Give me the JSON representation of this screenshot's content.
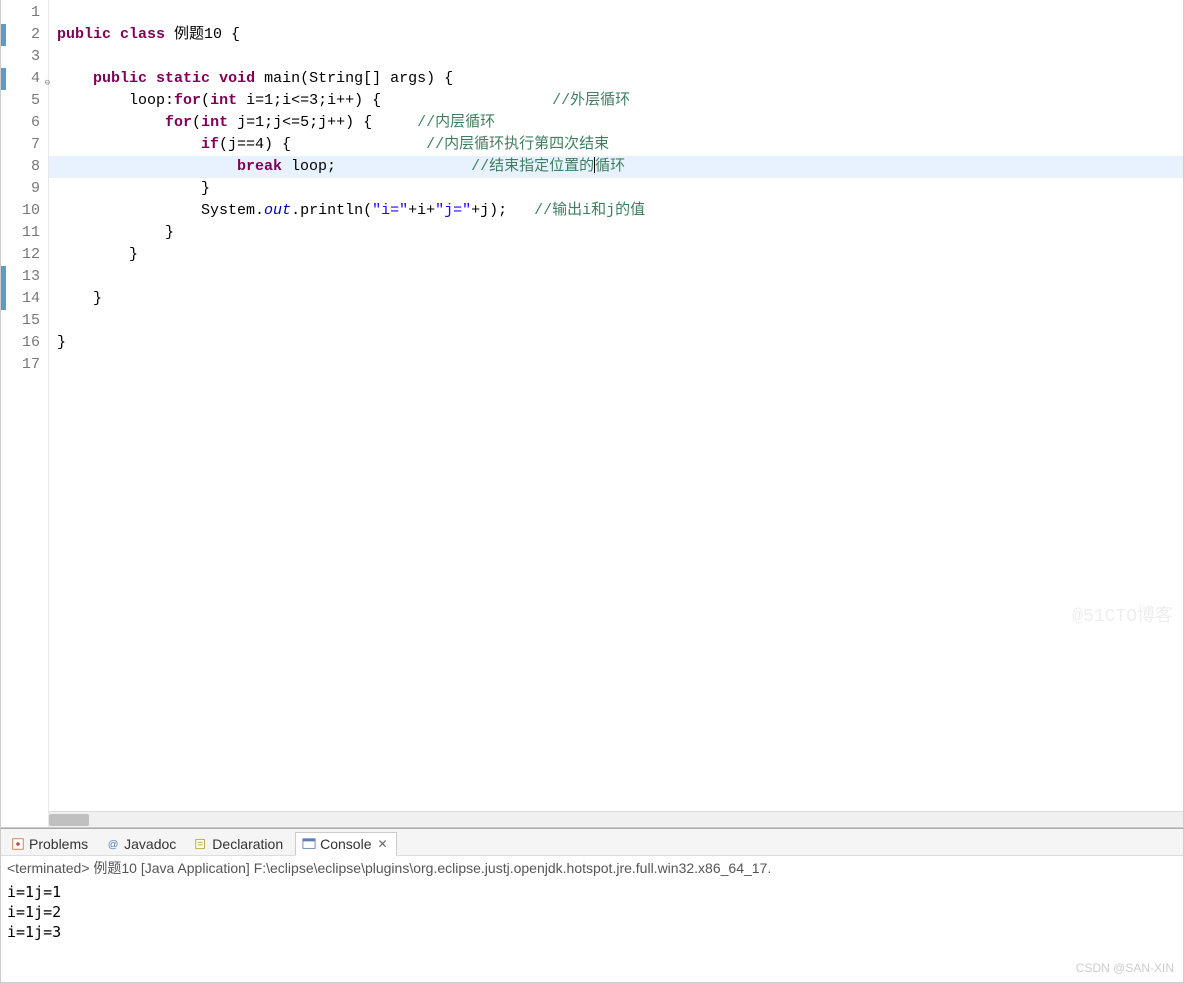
{
  "gutter": {
    "lines": [
      {
        "n": "1"
      },
      {
        "n": "2",
        "blue": true
      },
      {
        "n": "3"
      },
      {
        "n": "4",
        "blue": true,
        "fold": "⊖"
      },
      {
        "n": "5"
      },
      {
        "n": "6"
      },
      {
        "n": "7"
      },
      {
        "n": "8"
      },
      {
        "n": "9"
      },
      {
        "n": "10"
      },
      {
        "n": "11"
      },
      {
        "n": "12"
      },
      {
        "n": "13",
        "blue": true
      },
      {
        "n": "14",
        "blue": true
      },
      {
        "n": "15"
      },
      {
        "n": "16"
      },
      {
        "n": "17"
      }
    ]
  },
  "code": {
    "l1": "",
    "l2": {
      "k1": "public",
      "sp1": " ",
      "k2": "class",
      "rest": " 例题10 {"
    },
    "l3": "",
    "l4": {
      "pad": "    ",
      "k1": "public",
      "sp1": " ",
      "k2": "static",
      "sp2": " ",
      "k3": "void",
      "rest": " main(String[] args) {"
    },
    "l5": {
      "pad": "        ",
      "a": "loop:",
      "k": "for",
      "b": "(",
      "k2": "int",
      "c": " i=1;i<=3;i++) {",
      "gap": "                   ",
      "cm": "//外层循环"
    },
    "l6": {
      "pad": "            ",
      "k": "for",
      "b": "(",
      "k2": "int",
      "c": " j=1;j<=5;j++) {",
      "gap": "     ",
      "cm": "//内层循环"
    },
    "l7": {
      "pad": "                ",
      "k": "if",
      "b": "(j==4) {",
      "gap": "               ",
      "cm": "//内层循环执行第四次结束"
    },
    "l8": {
      "pad": "                    ",
      "k": "break",
      "b": " loop;",
      "gap": "               ",
      "cm1": "//结束指定位置的",
      "cm2": "循环"
    },
    "l9": {
      "pad": "                ",
      "t": "}"
    },
    "l10": {
      "pad": "                ",
      "a": "System.",
      "fld": "out",
      "b": ".println(",
      "s1": "\"i=\"",
      "c": "+i+",
      "s2": "\"j=\"",
      "d": "+j);",
      "gap": "   ",
      "cm": "//输出i和j的值"
    },
    "l11": {
      "pad": "            ",
      "t": "}"
    },
    "l12": {
      "pad": "        ",
      "t": "}"
    },
    "l13": "",
    "l14": {
      "pad": "    ",
      "t": "}"
    },
    "l15": "",
    "l16": {
      "pad": "",
      "t": "}"
    },
    "l17": ""
  },
  "tabs": {
    "problems": "Problems",
    "javadoc": "Javadoc",
    "declaration": "Declaration",
    "console": "Console"
  },
  "console": {
    "header": "<terminated> 例题10 [Java Application] F:\\eclipse\\eclipse\\plugins\\org.eclipse.justj.openjdk.hotspot.jre.full.win32.x86_64_17.",
    "out": [
      "i=1j=1",
      "i=1j=2",
      "i=1j=3"
    ]
  },
  "watermark": {
    "w1": "@51CTO博客",
    "w2": "CSDN @SAN-XIN"
  }
}
